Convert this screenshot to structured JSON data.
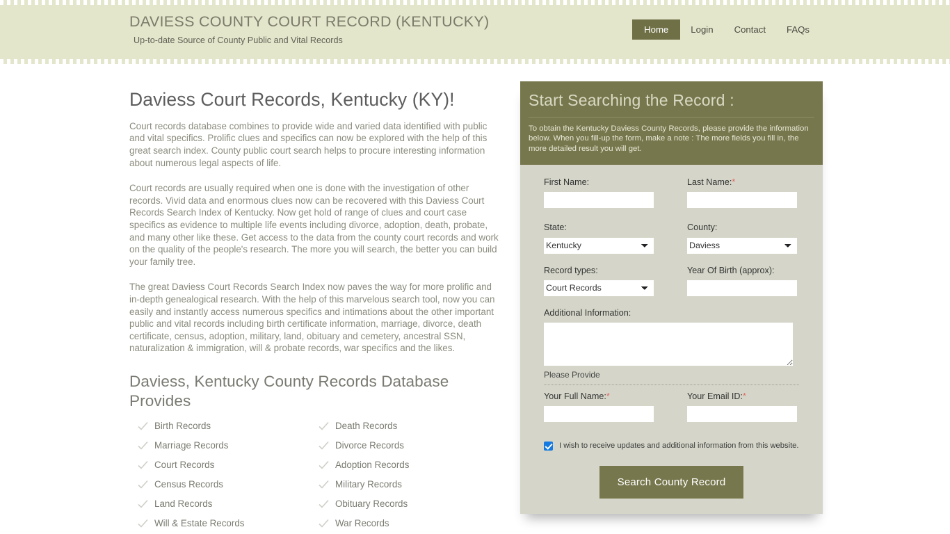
{
  "header": {
    "site_title": "DAVIESS COUNTY COURT RECORD (KENTUCKY)",
    "tagline": "Up-to-date Source of  County Public and Vital Records",
    "nav": [
      {
        "label": "Home",
        "active": true
      },
      {
        "label": "Login",
        "active": false
      },
      {
        "label": "Contact",
        "active": false
      },
      {
        "label": "FAQs",
        "active": false
      }
    ],
    "accent_color": "#6f7046",
    "background_color": "#e4e6cb"
  },
  "main": {
    "title": "Daviess Court Records, Kentucky (KY)!",
    "paragraphs": [
      "Court records database combines to provide wide and varied data identified with public and vital specifics. Prolific clues and specifics can now be explored with the help of this great search index. County public court search helps to procure interesting information about numerous legal aspects of life.",
      "Court records are usually required when one is done with the investigation of other records. Vivid data and enormous clues now can be recovered with this Daviess Court Records Search Index of Kentucky. Now get hold of range of clues and court case specifics as evidence to multiple life events including divorce, adoption, death, probate, and many other like these. Get access to the data from the county court records and work on the quality of the people's research. The more you will search, the better you can build your family tree.",
      "The great Daviess Court Records Search Index now paves the way for more prolific and in-depth genealogical research. With the help of this marvelous search tool, now you can easily and instantly access numerous specifics and intimations about the other important public and vital records including birth certificate information, marriage, divorce, death certificate, census, adoption, military, land, obituary and cemetery, ancestral SSN, naturalization & immigration, will & probate records, war specifics and the likes."
    ],
    "records_heading": "Daviess, Kentucky County Records Database Provides",
    "records": [
      "Birth Records",
      "Death Records",
      "Marriage Records",
      "Divorce Records",
      "Court Records",
      "Adoption Records",
      "Census Records",
      "Military Records",
      "Land Records",
      "Obituary Records",
      "Will & Estate Records",
      "War Records"
    ]
  },
  "form": {
    "panel_title": "Start Searching the Record :",
    "panel_intro": "To obtain the Kentucky Daviess County Records, please provide the information below. When you fill-up the form, make a note : The more fields you fill in, the more detailed result you will get.",
    "first_name_label": "First Name:",
    "first_name_value": "",
    "last_name_label": "Last Name:",
    "last_name_required": "*",
    "last_name_value": "",
    "state_label": "State:",
    "state_value": "Kentucky",
    "state_options": [
      "Kentucky"
    ],
    "county_label": "County:",
    "county_value": "Daviess",
    "county_options": [
      "Daviess"
    ],
    "record_types_label": "Record types:",
    "record_types_value": "Court Records",
    "record_types_options": [
      "Court Records"
    ],
    "year_of_birth_label": "Year Of Birth (approx):",
    "year_of_birth_value": "",
    "additional_info_label": "Additional Information:",
    "additional_info_value": "",
    "please_provide": "Please Provide",
    "full_name_label": "Your Full Name:",
    "full_name_required": "*",
    "full_name_value": "",
    "email_label": "Your Email ID:",
    "email_required": "*",
    "email_value": "",
    "newsletter_label": "I wish to receive updates and additional information from this website.",
    "newsletter_checked": true,
    "submit_label": "Search County Record",
    "panel_header_color": "#77774d",
    "panel_body_color": "#d5d6c9",
    "checkbox_color": "#1479e0",
    "required_color": "#e2655f"
  }
}
